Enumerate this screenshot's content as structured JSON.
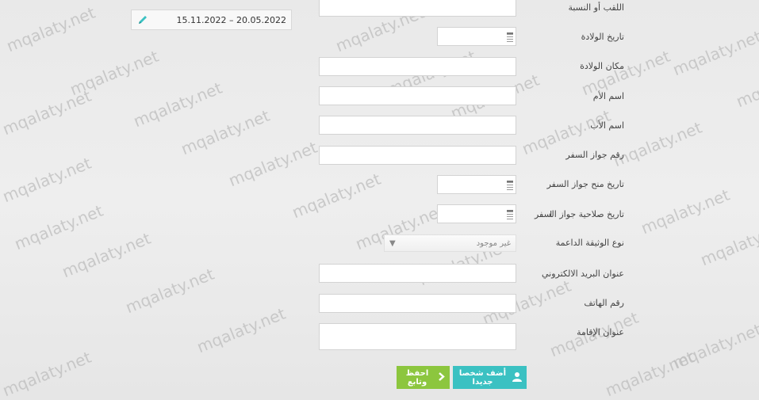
{
  "header": {
    "date_range": "15.11.2022 – 20.05.2022"
  },
  "form": {
    "surname_label": "اللقب أو النسبة",
    "birth_date_label": "تاريخ الولادة",
    "birth_place_label": "مكان الولادة",
    "mother_name_label": "اسم الأم",
    "father_name_label": "اسم الأب",
    "passport_number_label": "رقم جواز السفر",
    "passport_issue_label": "تاريخ منح جواز السفر",
    "passport_expiry_label": "تاريخ صلاحية جواز السفر",
    "document_type_label": "نوع الوثيقة الداعمة",
    "document_type_value": "غير موجود",
    "email_label": "عنوان البريد الالكتروني",
    "phone_label": "رقم الهاتف",
    "address_label": "عنوان الإقامة"
  },
  "buttons": {
    "add_person": "أضف شخصا جديدا",
    "save_continue": "احفظ وتابع"
  },
  "watermark": "mqalaty.net",
  "colors": {
    "add_button": "#3bc1c2",
    "save_button": "#8cc63e"
  }
}
